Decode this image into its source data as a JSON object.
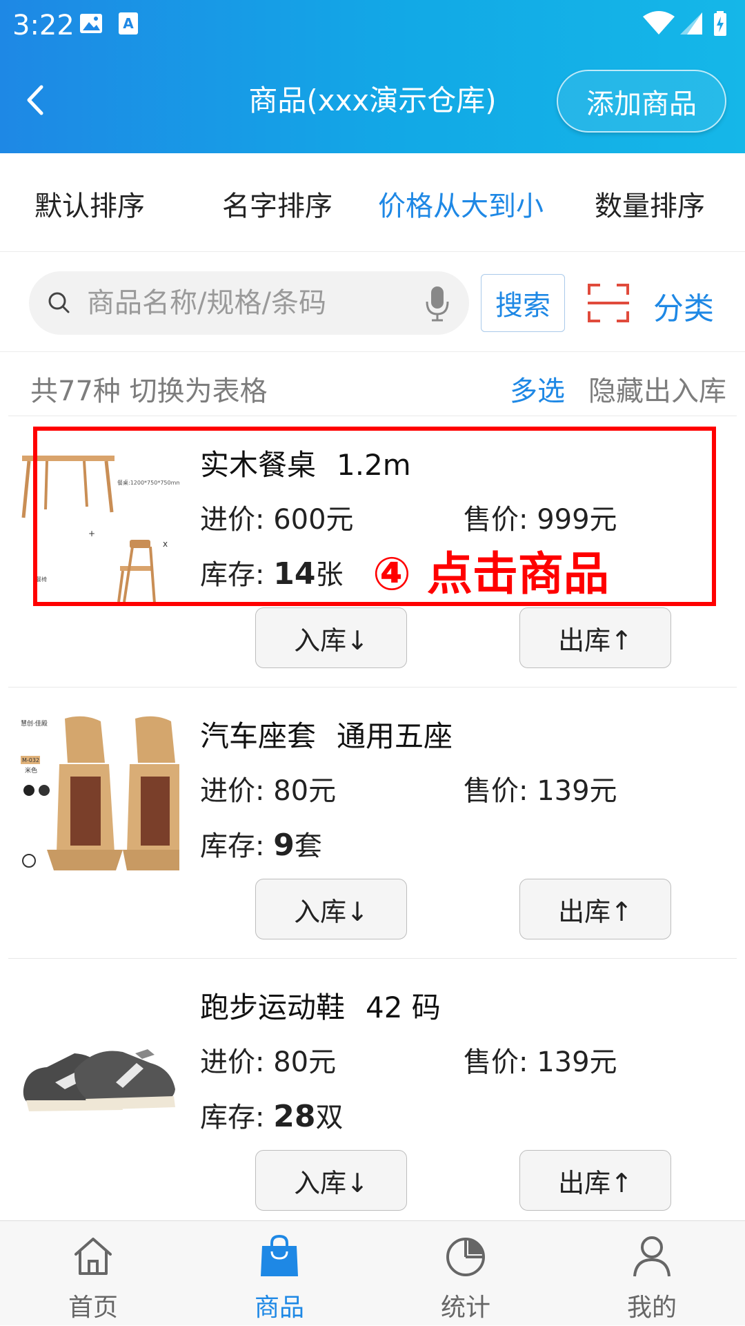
{
  "status_bar": {
    "time": "3:22"
  },
  "header": {
    "title": "商品(xxx演示仓库)",
    "add_button": "添加商品"
  },
  "sort_tabs": [
    {
      "label": "默认排序",
      "active": false
    },
    {
      "label": "名字排序",
      "active": false
    },
    {
      "label": "价格从大到小",
      "active": true
    },
    {
      "label": "数量排序",
      "active": false
    }
  ],
  "search": {
    "placeholder": "商品名称/规格/条码",
    "button": "搜索",
    "category": "分类"
  },
  "info": {
    "count_text": "共77种 切换为表格",
    "multi_select": "多选",
    "hide_io": "隐藏出入库"
  },
  "products": [
    {
      "name": "实木餐桌",
      "spec": "1.2m",
      "buy_label": "进价:",
      "buy_price": "600元",
      "sell_label": "售价:",
      "sell_price": "999元",
      "stock_label": "库存:",
      "stock_qty": "14",
      "stock_unit": "张",
      "in_button": "入库↓",
      "out_button": "出库↑"
    },
    {
      "name": "汽车座套",
      "spec": "通用五座",
      "buy_label": "进价:",
      "buy_price": "80元",
      "sell_label": "售价:",
      "sell_price": "139元",
      "stock_label": "库存:",
      "stock_qty": "9",
      "stock_unit": "套",
      "in_button": "入库↓",
      "out_button": "出库↑"
    },
    {
      "name": "跑步运动鞋",
      "spec": "42 码",
      "buy_label": "进价:",
      "buy_price": "80元",
      "sell_label": "售价:",
      "sell_price": "139元",
      "stock_label": "库存:",
      "stock_qty": "28",
      "stock_unit": "双",
      "in_button": "入库↓",
      "out_button": "出库↑"
    }
  ],
  "thumb_text": {
    "table_spec": "餐桌:1200*750*750mm",
    "chair_label": "餐椅",
    "seat_brand": "M-032",
    "seat_color": "米色"
  },
  "annotation": {
    "text": "④ 点击商品",
    "color": "#ff0000"
  },
  "bottom_nav": [
    {
      "label": "首页",
      "icon": "home-icon",
      "active": false
    },
    {
      "label": "商品",
      "icon": "shopping-bag-icon",
      "active": true
    },
    {
      "label": "统计",
      "icon": "pie-chart-icon",
      "active": false
    },
    {
      "label": "我的",
      "icon": "user-icon",
      "active": false
    }
  ],
  "colors": {
    "accent": "#1e88e5",
    "header_start": "#1e88e5",
    "header_end": "#15b7e8",
    "highlight": "#ff0000"
  }
}
